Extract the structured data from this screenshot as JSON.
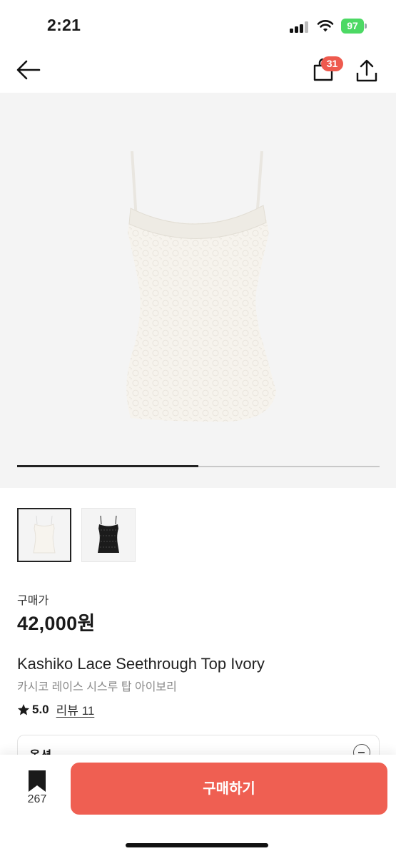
{
  "status_bar": {
    "time": "2:21",
    "battery": "97"
  },
  "header": {
    "cart_count": "31"
  },
  "gallery": {
    "progress": 0.5,
    "thumbnails": [
      "ivory",
      "black"
    ]
  },
  "product": {
    "price_label": "구매가",
    "price": "42,000원",
    "title_en": "Kashiko Lace Seethrough Top Ivory",
    "title_ko": "카시코 레이스 시스루 탑 아이보리",
    "rating": "5.0",
    "reviews": "리뷰 11"
  },
  "options": {
    "label": "옵션"
  },
  "bottom_bar": {
    "bookmark_count": "267",
    "buy_label": "구매하기"
  },
  "colors": {
    "accent": "#ef5f52",
    "badge": "#ee5a4e",
    "battery": "#4cd964"
  },
  "icons": [
    "back-arrow-icon",
    "shopping-bag-icon",
    "share-icon",
    "star-icon",
    "bookmark-icon"
  ]
}
